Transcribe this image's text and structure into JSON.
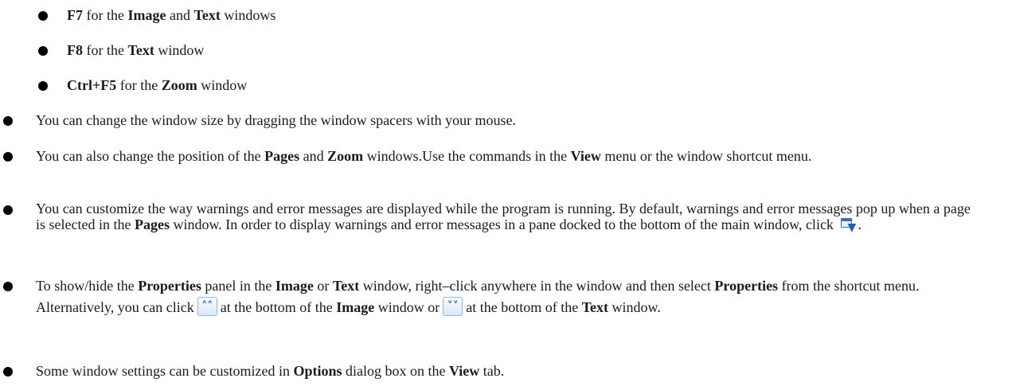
{
  "sub_items": [
    {
      "key": "F7",
      "mid": "for the",
      "b1": "Image",
      "and": "and",
      "b2": "Text",
      "end": "windows"
    },
    {
      "key": "F8",
      "mid": "for the",
      "b1": "Text",
      "end": "window"
    },
    {
      "key": "Ctrl+F5",
      "mid": "for the",
      "b1": "Zoom",
      "end": "window"
    }
  ],
  "items": {
    "window_size": "You can change the window size by dragging the window spacers with your mouse.",
    "position": {
      "t1": "You can also change the position of the",
      "b1": "Pages",
      "t2": "and",
      "b2": "Zoom",
      "t3": "windows.Use the commands in the",
      "b3": "View",
      "t4": "menu or the window shortcut menu."
    },
    "warnings": {
      "t1": "You can customize the way warnings and error messages are displayed while the program is running. By default, warnings and error messages pop up when a page is selected in the",
      "b1": "Pages",
      "t2": "window. In order to display warnings and error messages in a pane docked to the bottom of the main window, click",
      "t3": "."
    },
    "properties": {
      "t1": "To show/hide the",
      "b1": "Properties",
      "t2": "panel in the",
      "b2": "Image",
      "t3": "or",
      "b3": "Text",
      "t4": "window, right–click anywhere in the window and then select",
      "b4": "Properties",
      "t5": "from the shortcut menu. Alternatively, you can click",
      "t6": "at the bottom of the",
      "b5": "Image",
      "t7": "window or",
      "t8": "at the bottom of the",
      "b6": "Text",
      "t9": "window."
    },
    "options": {
      "t1": "Some window settings can be customized in",
      "b1": "Options",
      "t2": "dialog box on the",
      "b2": "View",
      "t3": "tab."
    }
  },
  "icons": {
    "dock_pane": "dock-pane-icon",
    "show_properties": "chevron-up-double-icon",
    "hide_properties": "chevron-down-double-icon"
  }
}
